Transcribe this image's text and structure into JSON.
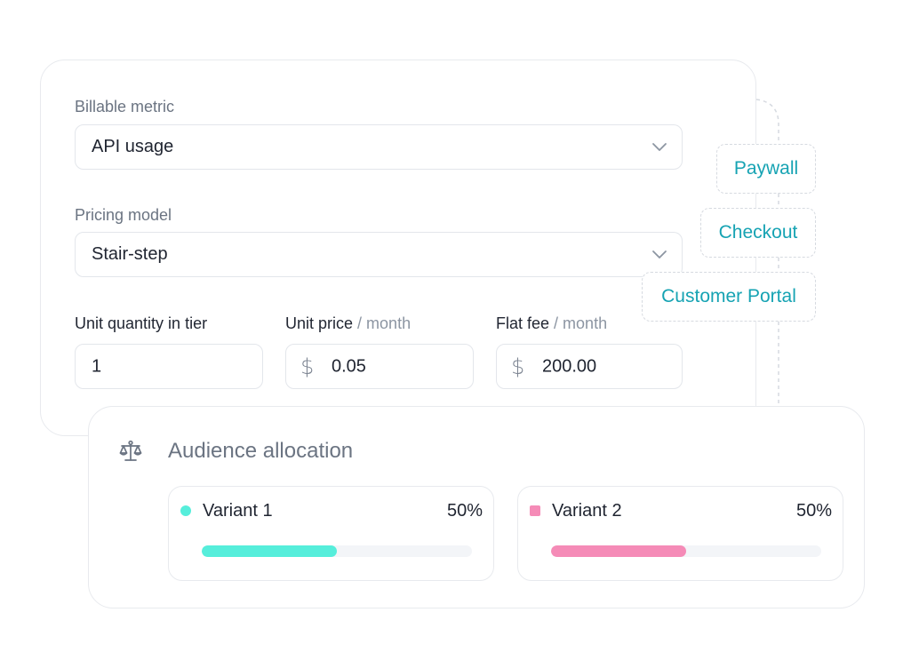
{
  "pricing": {
    "billable_metric": {
      "label": "Billable metric",
      "value": "API usage"
    },
    "pricing_model": {
      "label": "Pricing model",
      "value": "Stair-step"
    },
    "unit_quantity": {
      "label": "Unit quantity in tier",
      "value": "1"
    },
    "unit_price": {
      "label": "Unit price",
      "unit": "/ month",
      "currency_symbol": "$",
      "value": "0.05"
    },
    "flat_fee": {
      "label": "Flat fee",
      "unit": "/ month",
      "currency_symbol": "$",
      "value": "200.00"
    }
  },
  "tags": [
    "Paywall",
    "Checkout",
    "Customer Portal"
  ],
  "audience": {
    "title": "Audience allocation",
    "icon": "scale-icon",
    "variants": [
      {
        "name": "Variant 1",
        "percent_label": "50%",
        "percent": 50,
        "color": "#56eedb",
        "marker": "circle"
      },
      {
        "name": "Variant 2",
        "percent_label": "50%",
        "percent": 50,
        "color": "#f58bb7",
        "marker": "square"
      }
    ]
  },
  "colors": {
    "accent": "#16a3b3",
    "label": "#6b7482",
    "border": "#e3e6eb"
  }
}
